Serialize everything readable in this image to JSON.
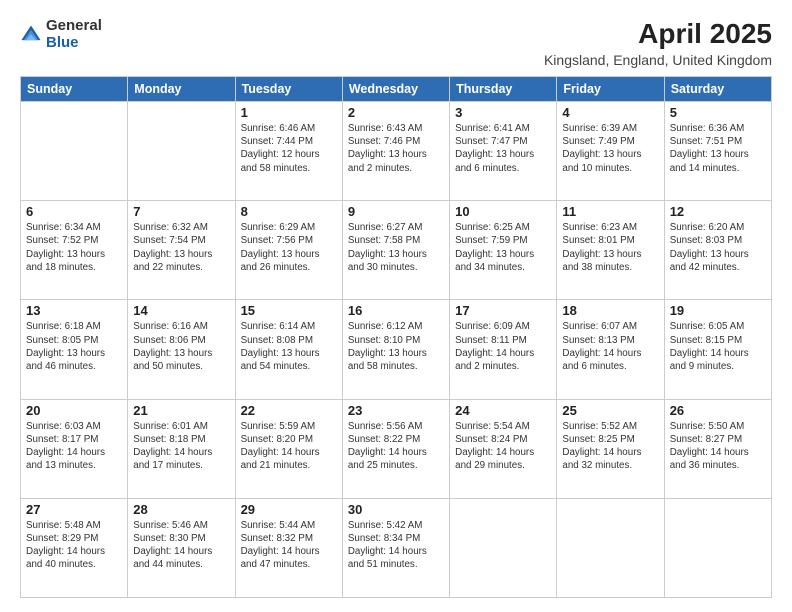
{
  "header": {
    "logo_line1": "General",
    "logo_line2": "Blue",
    "main_title": "April 2025",
    "subtitle": "Kingsland, England, United Kingdom"
  },
  "days_of_week": [
    "Sunday",
    "Monday",
    "Tuesday",
    "Wednesday",
    "Thursday",
    "Friday",
    "Saturday"
  ],
  "weeks": [
    [
      {
        "day": "",
        "info": ""
      },
      {
        "day": "",
        "info": ""
      },
      {
        "day": "1",
        "info": "Sunrise: 6:46 AM\nSunset: 7:44 PM\nDaylight: 12 hours and 58 minutes."
      },
      {
        "day": "2",
        "info": "Sunrise: 6:43 AM\nSunset: 7:46 PM\nDaylight: 13 hours and 2 minutes."
      },
      {
        "day": "3",
        "info": "Sunrise: 6:41 AM\nSunset: 7:47 PM\nDaylight: 13 hours and 6 minutes."
      },
      {
        "day": "4",
        "info": "Sunrise: 6:39 AM\nSunset: 7:49 PM\nDaylight: 13 hours and 10 minutes."
      },
      {
        "day": "5",
        "info": "Sunrise: 6:36 AM\nSunset: 7:51 PM\nDaylight: 13 hours and 14 minutes."
      }
    ],
    [
      {
        "day": "6",
        "info": "Sunrise: 6:34 AM\nSunset: 7:52 PM\nDaylight: 13 hours and 18 minutes."
      },
      {
        "day": "7",
        "info": "Sunrise: 6:32 AM\nSunset: 7:54 PM\nDaylight: 13 hours and 22 minutes."
      },
      {
        "day": "8",
        "info": "Sunrise: 6:29 AM\nSunset: 7:56 PM\nDaylight: 13 hours and 26 minutes."
      },
      {
        "day": "9",
        "info": "Sunrise: 6:27 AM\nSunset: 7:58 PM\nDaylight: 13 hours and 30 minutes."
      },
      {
        "day": "10",
        "info": "Sunrise: 6:25 AM\nSunset: 7:59 PM\nDaylight: 13 hours and 34 minutes."
      },
      {
        "day": "11",
        "info": "Sunrise: 6:23 AM\nSunset: 8:01 PM\nDaylight: 13 hours and 38 minutes."
      },
      {
        "day": "12",
        "info": "Sunrise: 6:20 AM\nSunset: 8:03 PM\nDaylight: 13 hours and 42 minutes."
      }
    ],
    [
      {
        "day": "13",
        "info": "Sunrise: 6:18 AM\nSunset: 8:05 PM\nDaylight: 13 hours and 46 minutes."
      },
      {
        "day": "14",
        "info": "Sunrise: 6:16 AM\nSunset: 8:06 PM\nDaylight: 13 hours and 50 minutes."
      },
      {
        "day": "15",
        "info": "Sunrise: 6:14 AM\nSunset: 8:08 PM\nDaylight: 13 hours and 54 minutes."
      },
      {
        "day": "16",
        "info": "Sunrise: 6:12 AM\nSunset: 8:10 PM\nDaylight: 13 hours and 58 minutes."
      },
      {
        "day": "17",
        "info": "Sunrise: 6:09 AM\nSunset: 8:11 PM\nDaylight: 14 hours and 2 minutes."
      },
      {
        "day": "18",
        "info": "Sunrise: 6:07 AM\nSunset: 8:13 PM\nDaylight: 14 hours and 6 minutes."
      },
      {
        "day": "19",
        "info": "Sunrise: 6:05 AM\nSunset: 8:15 PM\nDaylight: 14 hours and 9 minutes."
      }
    ],
    [
      {
        "day": "20",
        "info": "Sunrise: 6:03 AM\nSunset: 8:17 PM\nDaylight: 14 hours and 13 minutes."
      },
      {
        "day": "21",
        "info": "Sunrise: 6:01 AM\nSunset: 8:18 PM\nDaylight: 14 hours and 17 minutes."
      },
      {
        "day": "22",
        "info": "Sunrise: 5:59 AM\nSunset: 8:20 PM\nDaylight: 14 hours and 21 minutes."
      },
      {
        "day": "23",
        "info": "Sunrise: 5:56 AM\nSunset: 8:22 PM\nDaylight: 14 hours and 25 minutes."
      },
      {
        "day": "24",
        "info": "Sunrise: 5:54 AM\nSunset: 8:24 PM\nDaylight: 14 hours and 29 minutes."
      },
      {
        "day": "25",
        "info": "Sunrise: 5:52 AM\nSunset: 8:25 PM\nDaylight: 14 hours and 32 minutes."
      },
      {
        "day": "26",
        "info": "Sunrise: 5:50 AM\nSunset: 8:27 PM\nDaylight: 14 hours and 36 minutes."
      }
    ],
    [
      {
        "day": "27",
        "info": "Sunrise: 5:48 AM\nSunset: 8:29 PM\nDaylight: 14 hours and 40 minutes."
      },
      {
        "day": "28",
        "info": "Sunrise: 5:46 AM\nSunset: 8:30 PM\nDaylight: 14 hours and 44 minutes."
      },
      {
        "day": "29",
        "info": "Sunrise: 5:44 AM\nSunset: 8:32 PM\nDaylight: 14 hours and 47 minutes."
      },
      {
        "day": "30",
        "info": "Sunrise: 5:42 AM\nSunset: 8:34 PM\nDaylight: 14 hours and 51 minutes."
      },
      {
        "day": "",
        "info": ""
      },
      {
        "day": "",
        "info": ""
      },
      {
        "day": "",
        "info": ""
      }
    ]
  ]
}
